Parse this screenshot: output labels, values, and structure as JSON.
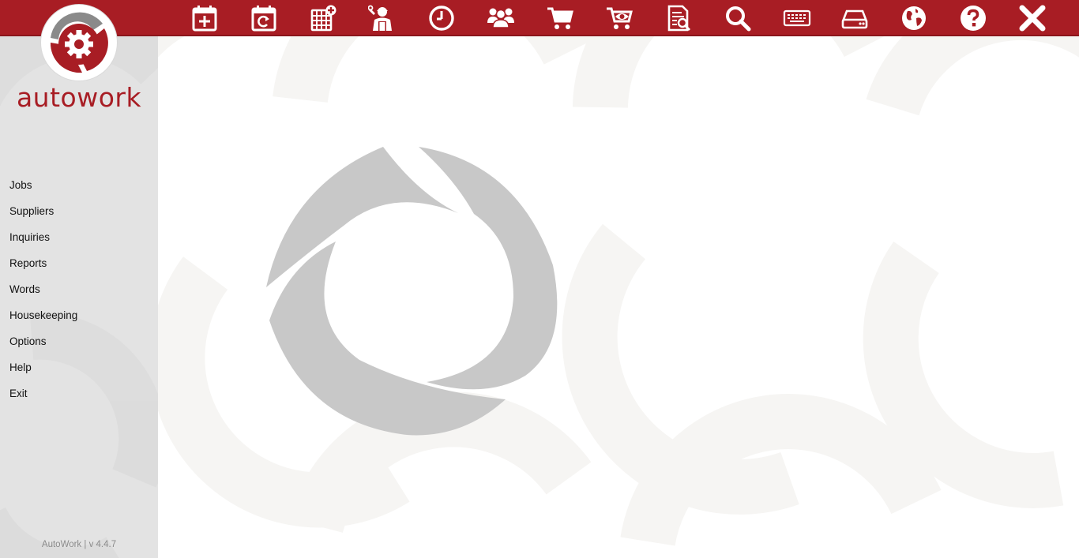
{
  "app": {
    "brand": "autowork",
    "version_label": "AutoWork | v 4.4.7"
  },
  "colors": {
    "accent": "#a81d24",
    "sidebar_bg": "#e3e3e3",
    "watermark": "#c8c8c8"
  },
  "toolbar": [
    {
      "name": "new-job",
      "icon": "calendar-plus-icon"
    },
    {
      "name": "repeat-job",
      "icon": "calendar-refresh-icon"
    },
    {
      "name": "schedule",
      "icon": "calendar-grid-plus-icon"
    },
    {
      "name": "mechanic",
      "icon": "mechanic-icon"
    },
    {
      "name": "timesheet",
      "icon": "clock-icon"
    },
    {
      "name": "customers",
      "icon": "users-icon"
    },
    {
      "name": "purchase",
      "icon": "cart-icon"
    },
    {
      "name": "view-purchases",
      "icon": "cart-eye-icon"
    },
    {
      "name": "document-search",
      "icon": "document-search-icon"
    },
    {
      "name": "search",
      "icon": "search-icon"
    },
    {
      "name": "keyboard",
      "icon": "keyboard-icon"
    },
    {
      "name": "drive",
      "icon": "hard-drive-icon"
    },
    {
      "name": "web",
      "icon": "globe-icon"
    },
    {
      "name": "help",
      "icon": "help-icon"
    },
    {
      "name": "close",
      "icon": "close-icon"
    }
  ],
  "sidebar": {
    "items": [
      {
        "label": "Jobs"
      },
      {
        "label": "Suppliers"
      },
      {
        "label": "Inquiries"
      },
      {
        "label": "Reports"
      },
      {
        "label": "Words"
      },
      {
        "label": "Housekeeping"
      },
      {
        "label": "Options"
      },
      {
        "label": "Help"
      },
      {
        "label": "Exit"
      }
    ]
  }
}
